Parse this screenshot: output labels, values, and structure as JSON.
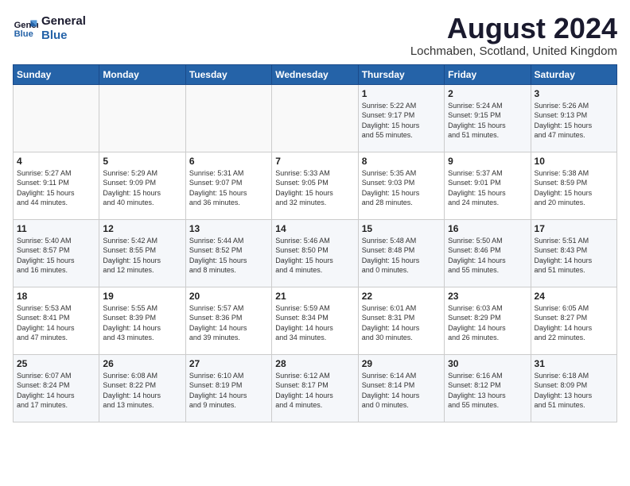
{
  "header": {
    "logo_line1": "General",
    "logo_line2": "Blue",
    "month_year": "August 2024",
    "location": "Lochmaben, Scotland, United Kingdom"
  },
  "days_of_week": [
    "Sunday",
    "Monday",
    "Tuesday",
    "Wednesday",
    "Thursday",
    "Friday",
    "Saturday"
  ],
  "weeks": [
    [
      {
        "day": "",
        "content": ""
      },
      {
        "day": "",
        "content": ""
      },
      {
        "day": "",
        "content": ""
      },
      {
        "day": "",
        "content": ""
      },
      {
        "day": "1",
        "content": "Sunrise: 5:22 AM\nSunset: 9:17 PM\nDaylight: 15 hours\nand 55 minutes."
      },
      {
        "day": "2",
        "content": "Sunrise: 5:24 AM\nSunset: 9:15 PM\nDaylight: 15 hours\nand 51 minutes."
      },
      {
        "day": "3",
        "content": "Sunrise: 5:26 AM\nSunset: 9:13 PM\nDaylight: 15 hours\nand 47 minutes."
      }
    ],
    [
      {
        "day": "4",
        "content": "Sunrise: 5:27 AM\nSunset: 9:11 PM\nDaylight: 15 hours\nand 44 minutes."
      },
      {
        "day": "5",
        "content": "Sunrise: 5:29 AM\nSunset: 9:09 PM\nDaylight: 15 hours\nand 40 minutes."
      },
      {
        "day": "6",
        "content": "Sunrise: 5:31 AM\nSunset: 9:07 PM\nDaylight: 15 hours\nand 36 minutes."
      },
      {
        "day": "7",
        "content": "Sunrise: 5:33 AM\nSunset: 9:05 PM\nDaylight: 15 hours\nand 32 minutes."
      },
      {
        "day": "8",
        "content": "Sunrise: 5:35 AM\nSunset: 9:03 PM\nDaylight: 15 hours\nand 28 minutes."
      },
      {
        "day": "9",
        "content": "Sunrise: 5:37 AM\nSunset: 9:01 PM\nDaylight: 15 hours\nand 24 minutes."
      },
      {
        "day": "10",
        "content": "Sunrise: 5:38 AM\nSunset: 8:59 PM\nDaylight: 15 hours\nand 20 minutes."
      }
    ],
    [
      {
        "day": "11",
        "content": "Sunrise: 5:40 AM\nSunset: 8:57 PM\nDaylight: 15 hours\nand 16 minutes."
      },
      {
        "day": "12",
        "content": "Sunrise: 5:42 AM\nSunset: 8:55 PM\nDaylight: 15 hours\nand 12 minutes."
      },
      {
        "day": "13",
        "content": "Sunrise: 5:44 AM\nSunset: 8:52 PM\nDaylight: 15 hours\nand 8 minutes."
      },
      {
        "day": "14",
        "content": "Sunrise: 5:46 AM\nSunset: 8:50 PM\nDaylight: 15 hours\nand 4 minutes."
      },
      {
        "day": "15",
        "content": "Sunrise: 5:48 AM\nSunset: 8:48 PM\nDaylight: 15 hours\nand 0 minutes."
      },
      {
        "day": "16",
        "content": "Sunrise: 5:50 AM\nSunset: 8:46 PM\nDaylight: 14 hours\nand 55 minutes."
      },
      {
        "day": "17",
        "content": "Sunrise: 5:51 AM\nSunset: 8:43 PM\nDaylight: 14 hours\nand 51 minutes."
      }
    ],
    [
      {
        "day": "18",
        "content": "Sunrise: 5:53 AM\nSunset: 8:41 PM\nDaylight: 14 hours\nand 47 minutes."
      },
      {
        "day": "19",
        "content": "Sunrise: 5:55 AM\nSunset: 8:39 PM\nDaylight: 14 hours\nand 43 minutes."
      },
      {
        "day": "20",
        "content": "Sunrise: 5:57 AM\nSunset: 8:36 PM\nDaylight: 14 hours\nand 39 minutes."
      },
      {
        "day": "21",
        "content": "Sunrise: 5:59 AM\nSunset: 8:34 PM\nDaylight: 14 hours\nand 34 minutes."
      },
      {
        "day": "22",
        "content": "Sunrise: 6:01 AM\nSunset: 8:31 PM\nDaylight: 14 hours\nand 30 minutes."
      },
      {
        "day": "23",
        "content": "Sunrise: 6:03 AM\nSunset: 8:29 PM\nDaylight: 14 hours\nand 26 minutes."
      },
      {
        "day": "24",
        "content": "Sunrise: 6:05 AM\nSunset: 8:27 PM\nDaylight: 14 hours\nand 22 minutes."
      }
    ],
    [
      {
        "day": "25",
        "content": "Sunrise: 6:07 AM\nSunset: 8:24 PM\nDaylight: 14 hours\nand 17 minutes."
      },
      {
        "day": "26",
        "content": "Sunrise: 6:08 AM\nSunset: 8:22 PM\nDaylight: 14 hours\nand 13 minutes."
      },
      {
        "day": "27",
        "content": "Sunrise: 6:10 AM\nSunset: 8:19 PM\nDaylight: 14 hours\nand 9 minutes."
      },
      {
        "day": "28",
        "content": "Sunrise: 6:12 AM\nSunset: 8:17 PM\nDaylight: 14 hours\nand 4 minutes."
      },
      {
        "day": "29",
        "content": "Sunrise: 6:14 AM\nSunset: 8:14 PM\nDaylight: 14 hours\nand 0 minutes."
      },
      {
        "day": "30",
        "content": "Sunrise: 6:16 AM\nSunset: 8:12 PM\nDaylight: 13 hours\nand 55 minutes."
      },
      {
        "day": "31",
        "content": "Sunrise: 6:18 AM\nSunset: 8:09 PM\nDaylight: 13 hours\nand 51 minutes."
      }
    ]
  ]
}
